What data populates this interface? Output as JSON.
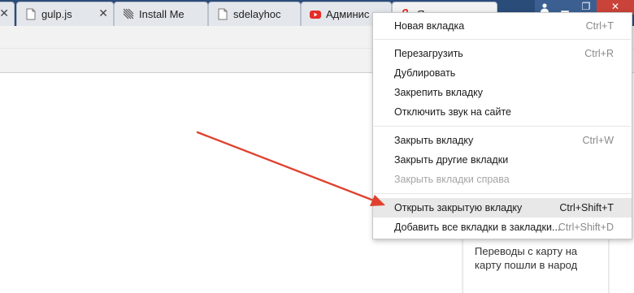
{
  "colors": {
    "tabstrip": "#2a4c79",
    "arrow": "#e0412f",
    "menu_bg": "#ffffff",
    "highlight": "#e8e8e8"
  },
  "tabs": [
    {
      "title": "",
      "icon": "document-icon"
    },
    {
      "title": "gulp.js",
      "icon": "document-icon"
    },
    {
      "title": "Install Me",
      "icon": "meteor-logo-icon"
    },
    {
      "title": "sdelayhoc",
      "icon": "document-icon"
    },
    {
      "title": "Админис",
      "icon": "youtube-icon"
    },
    {
      "title": "Яндекс",
      "icon": "yandex-icon"
    }
  ],
  "window_controls": [
    "profile-icon",
    "minimize-icon",
    "restore-icon",
    "close-icon"
  ],
  "menu": {
    "items": [
      {
        "label": "Новая вкладка",
        "shortcut": "Ctrl+T"
      },
      {
        "label": "Перезагрузить",
        "shortcut": "Ctrl+R"
      },
      {
        "label": "Дублировать",
        "shortcut": ""
      },
      {
        "label": "Закрепить вкладку",
        "shortcut": ""
      },
      {
        "label": "Отключить звук на сайте",
        "shortcut": ""
      },
      {
        "label": "Закрыть вкладку",
        "shortcut": "Ctrl+W"
      },
      {
        "label": "Закрыть другие вкладки",
        "shortcut": ""
      },
      {
        "label": "Закрыть вкладки справа",
        "shortcut": "",
        "disabled": true
      },
      {
        "label": "Открыть закрытую вкладку",
        "shortcut": "Ctrl+Shift+T",
        "highlighted": true
      },
      {
        "label": "Добавить все вкладки в закладки...",
        "shortcut": "Ctrl+Shift+D"
      }
    ]
  },
  "card": {
    "text": "Переводы с карту на карту пошли в народ"
  }
}
